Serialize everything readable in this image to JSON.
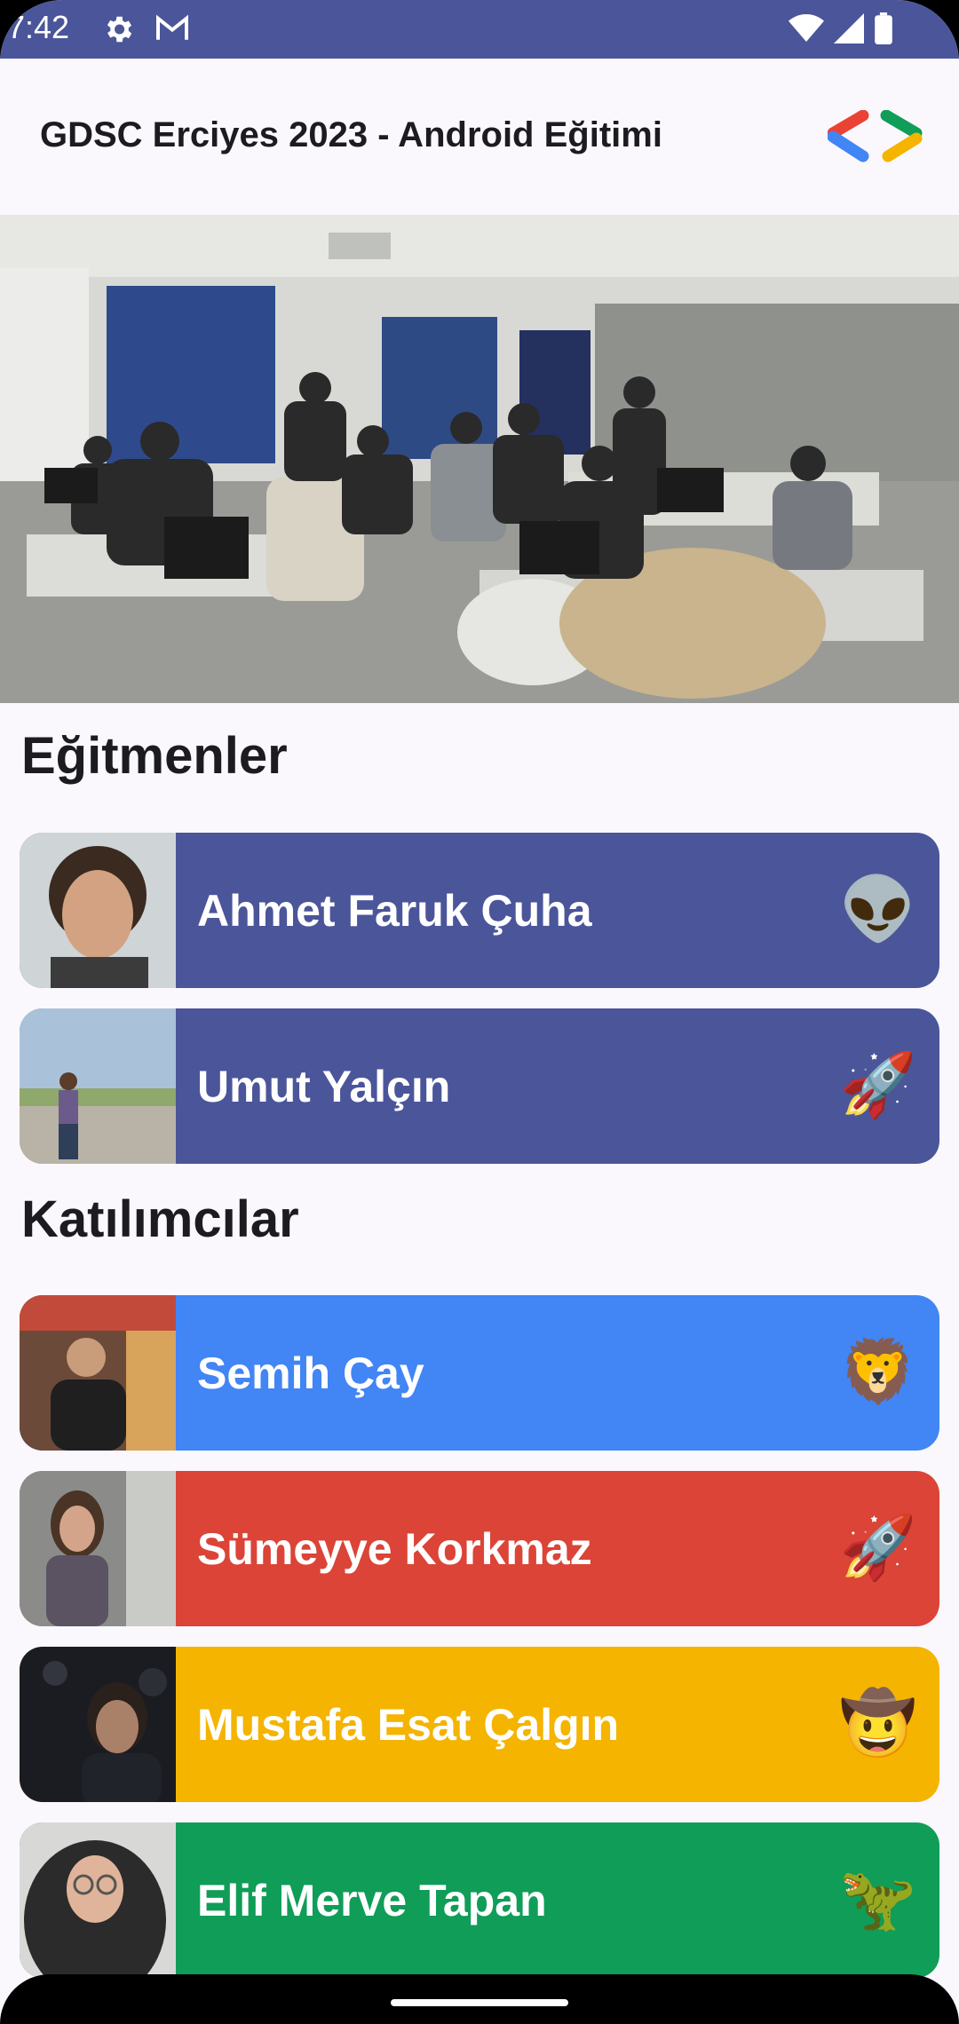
{
  "status_bar": {
    "time": "7:42",
    "icons": [
      "gear-icon",
      "gmail-icon",
      "wifi-icon",
      "signal-icon",
      "battery-icon"
    ],
    "color": "#4b5599"
  },
  "app_bar": {
    "title": "GDSC Erciyes 2023 - Android Eğitimi",
    "logo": "gdsc-logo-icon"
  },
  "hero": {
    "image": "group-photo-classroom"
  },
  "sections": {
    "instructors_title": "Eğitmenler",
    "participants_title": "Katılımcılar"
  },
  "instructors": [
    {
      "name": "Ahmet Faruk Çuha",
      "emoji": "👽",
      "emoji_name": "alien-icon",
      "color": "#4b5599"
    },
    {
      "name": "Umut Yalçın",
      "emoji": "🚀",
      "emoji_name": "rocket-icon",
      "color": "#4b5599"
    }
  ],
  "participants": [
    {
      "name": "Semih Çay",
      "emoji": "🦁",
      "emoji_name": "lion-icon",
      "color": "#4285f4"
    },
    {
      "name": "Sümeyye Korkmaz",
      "emoji": "🚀",
      "emoji_name": "rocket-icon",
      "color": "#db4437"
    },
    {
      "name": "Mustafa Esat Çalgın",
      "emoji": "🤠",
      "emoji_name": "cowboy-icon",
      "color": "#f4b400"
    },
    {
      "name": "Elif Merve Tapan",
      "emoji": "🦖",
      "emoji_name": "dinosaur-icon",
      "color": "#0f9d58"
    }
  ]
}
